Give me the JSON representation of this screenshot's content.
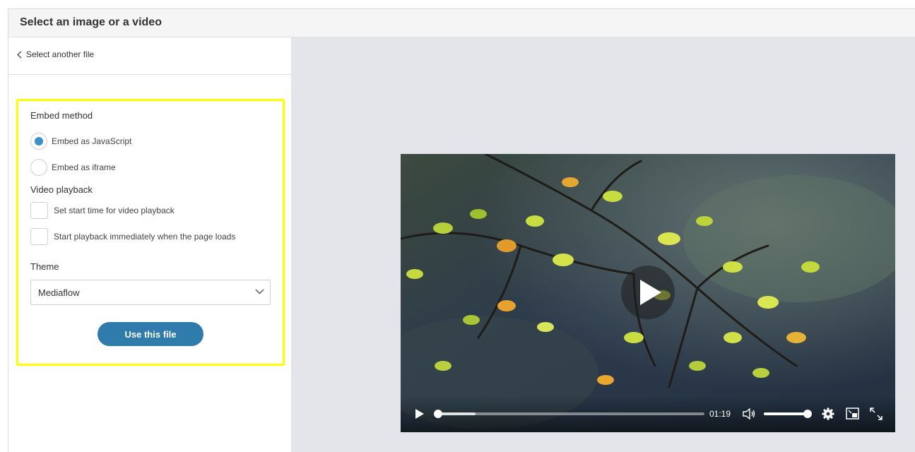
{
  "window": {
    "title": "Select an image or a video"
  },
  "sidebar": {
    "back_link": "Select another file",
    "embed_method": {
      "label": "Embed method",
      "options": [
        {
          "label": "Embed as JavaScript",
          "selected": true
        },
        {
          "label": "Embed as iframe",
          "selected": false
        }
      ]
    },
    "video_playback": {
      "label": "Video playback",
      "options": [
        {
          "label": "Set start time for video playback",
          "checked": false
        },
        {
          "label": "Start playback immediately when the page loads",
          "checked": false
        }
      ]
    },
    "theme": {
      "label": "Theme",
      "selected": "Mediaflow"
    },
    "use_button": "Use this file"
  },
  "player": {
    "time": "01:19",
    "progress": 0.0,
    "buffered": 0.14,
    "volume": 1.0,
    "icons": [
      "play-icon",
      "volume-icon",
      "settings-icon",
      "picture-in-picture-icon",
      "fullscreen-icon"
    ]
  },
  "colors": {
    "accent": "#2e7bac",
    "radio_selected": "#3b8fcb",
    "highlight_border": "#ffff00",
    "preview_background": "#e4e5ea"
  }
}
